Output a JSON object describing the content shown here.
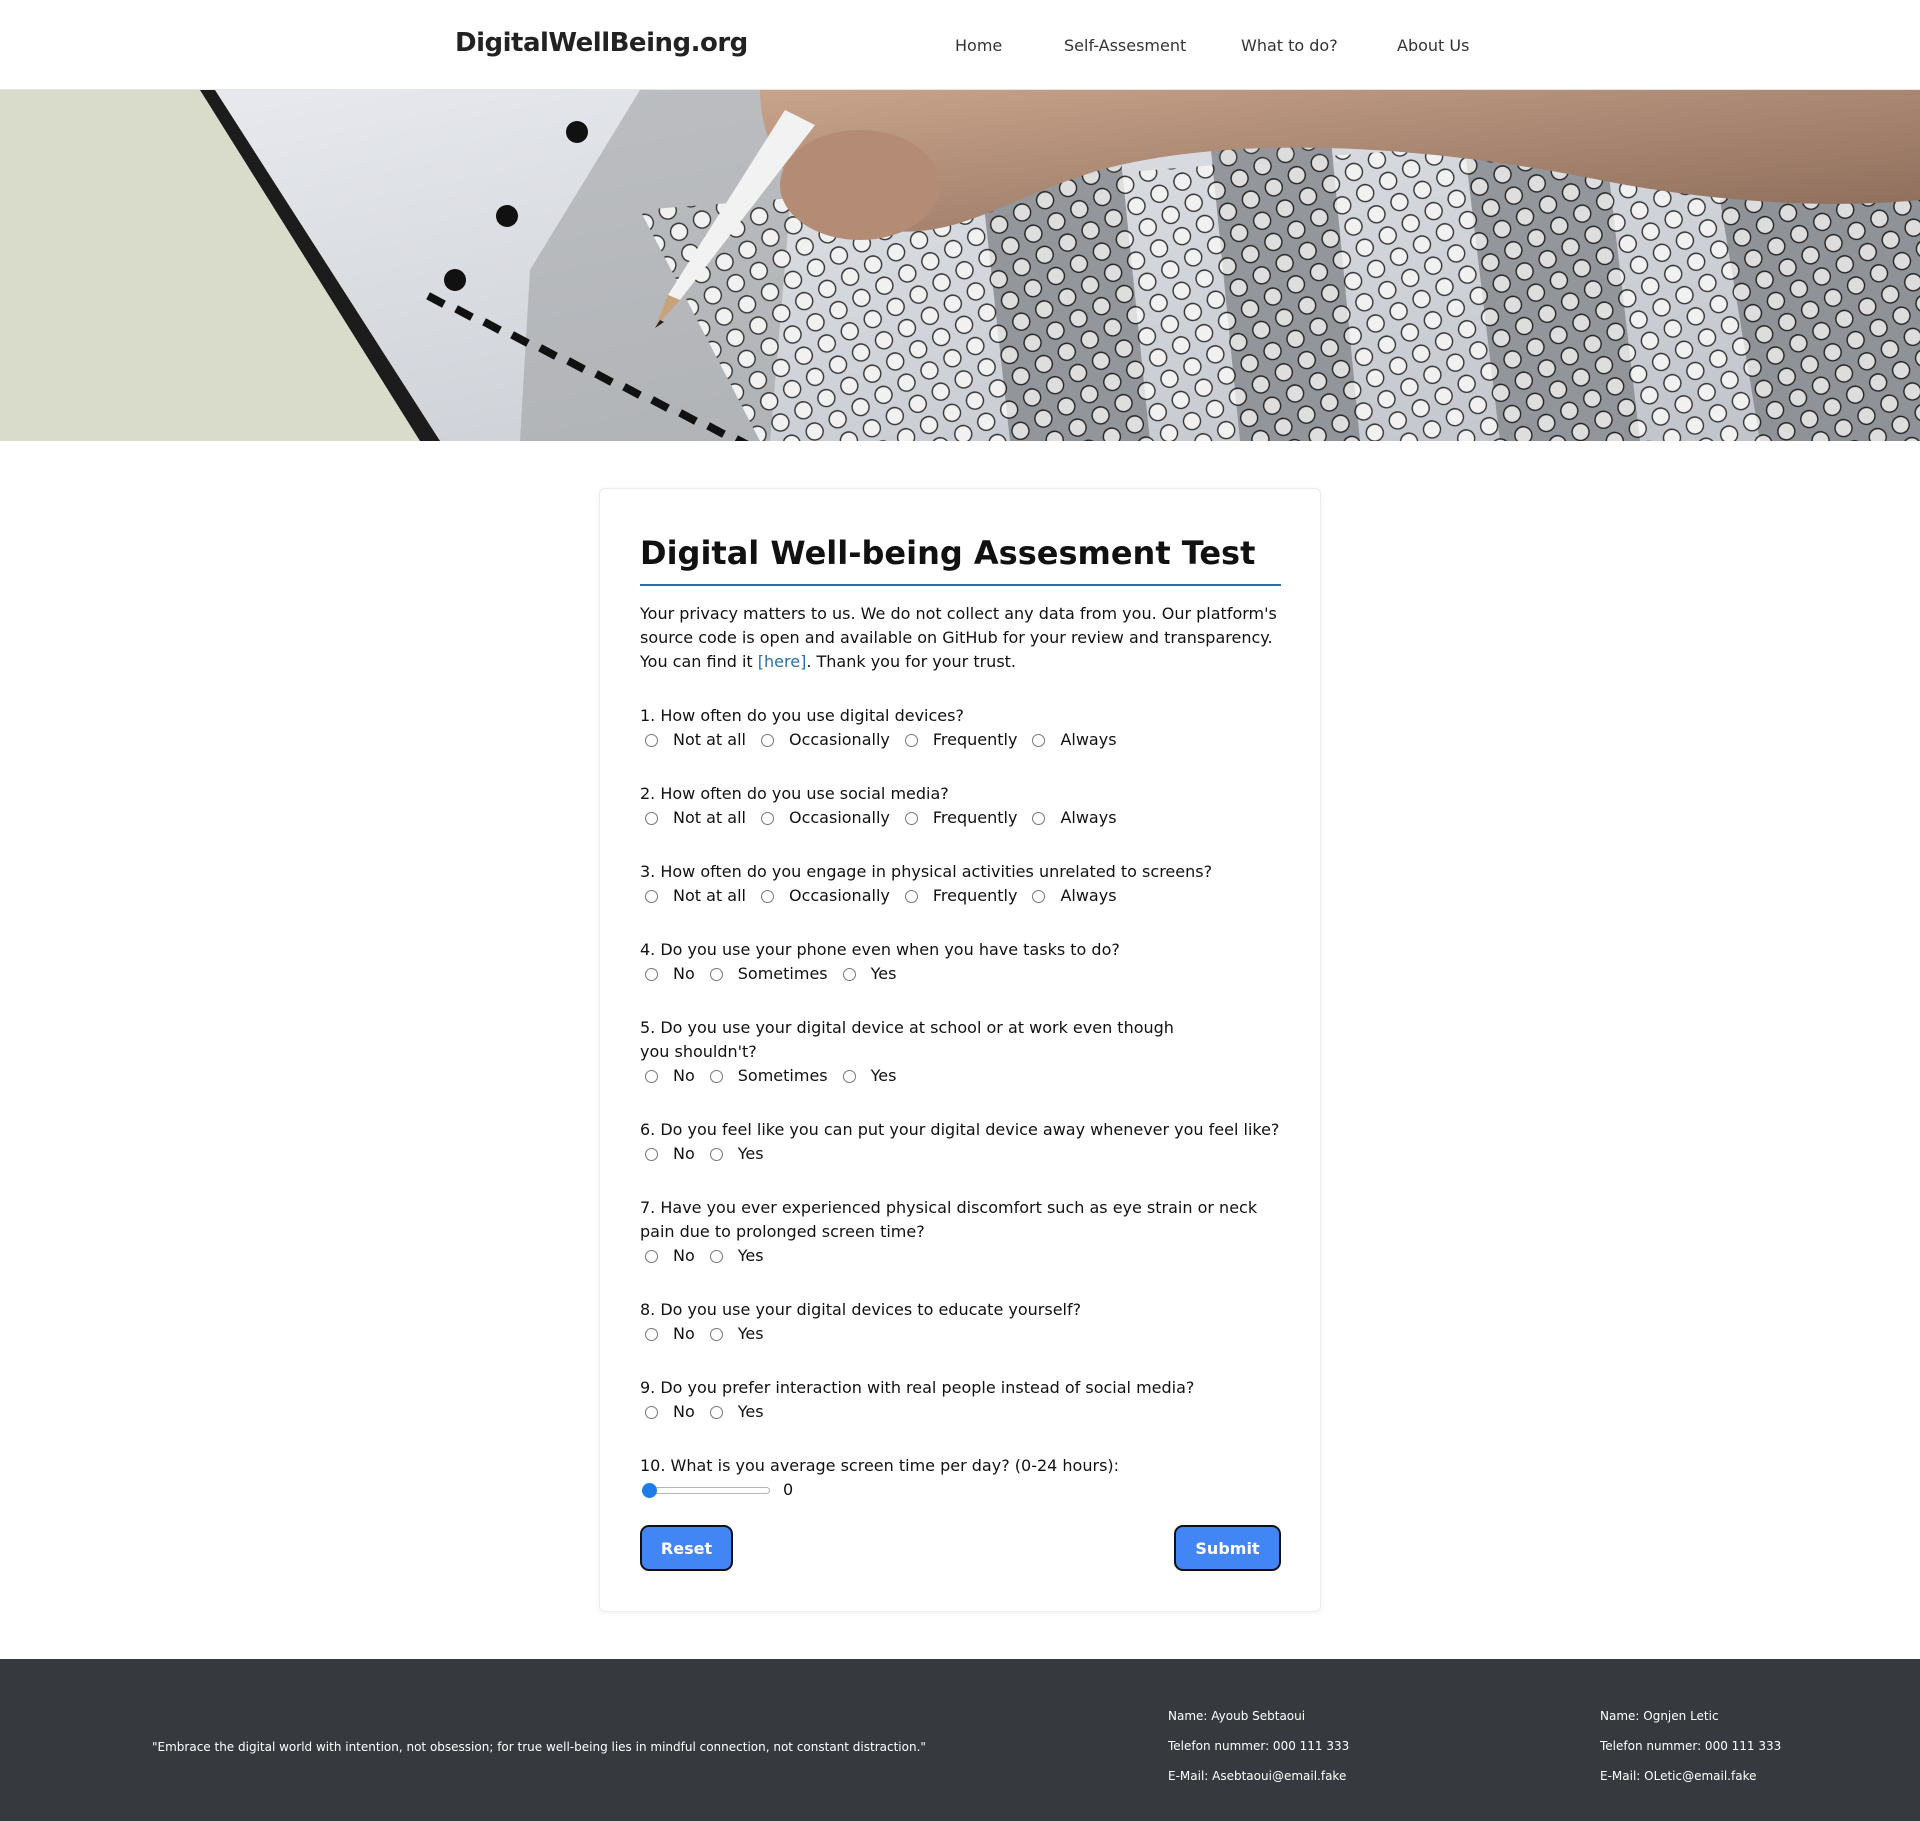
{
  "header": {
    "logo": "DigitalWellBeing.org",
    "nav": [
      "Home",
      "Self-Assesment",
      "What to do?",
      "About Us"
    ]
  },
  "hero": {
    "image_description": "Close-up of a pencil filling in bubbles on a multiple-choice answer sheet"
  },
  "form": {
    "title": "Digital Well-being Assesment Test",
    "intro_before_link": "Your privacy matters to us. We do not collect any data from you. Our platform's source code is open and available on GitHub for your review and transparency. You can find it ",
    "intro_link": "[here]",
    "intro_after_link": ". Thank you for your trust.",
    "questions": [
      {
        "text": "1. How often do you use digital devices?",
        "options": [
          "Not at all",
          "Occasionally",
          "Frequently",
          "Always"
        ]
      },
      {
        "text": "2. How often do you use social media?",
        "options": [
          "Not at all",
          "Occasionally",
          "Frequently",
          "Always"
        ]
      },
      {
        "text": "3. How often do you engage in physical activities unrelated to screens?",
        "options": [
          "Not at all",
          "Occasionally",
          "Frequently",
          "Always"
        ]
      },
      {
        "text": "4. Do you use your phone even when you have tasks to do?",
        "options": [
          "No",
          "Sometimes",
          "Yes"
        ]
      },
      {
        "text": "5. Do you use your digital device at school or at work even though you shouldn't?",
        "options": [
          "No",
          "Sometimes",
          "Yes"
        ]
      },
      {
        "text": "6. Do you feel like you can put your digital device away whenever you feel like?",
        "options": [
          "No",
          "Yes"
        ]
      },
      {
        "text": "7. Have you ever experienced physical discomfort such as eye strain or neck pain due to prolonged screen time?",
        "options": [
          "No",
          "Yes"
        ]
      },
      {
        "text": "8. Do you use your digital devices to educate yourself?",
        "options": [
          "No",
          "Yes"
        ]
      },
      {
        "text": "9. Do you prefer interaction with real people instead of social media?",
        "options": [
          "No",
          "Yes"
        ]
      }
    ],
    "slider_question": {
      "text": "10. What is you average screen time per day? (0-24 hours):",
      "min": 0,
      "max": 24,
      "value": "0"
    },
    "reset_label": "Reset",
    "submit_label": "Submit"
  },
  "footer": {
    "quote": "\"Embrace the digital world with intention, not obsession; for true well-being lies in mindful connection, not constant distraction.\"",
    "contacts": [
      {
        "name": "Name: Ayoub Sebtaoui",
        "phone": "Telefon nummer: 000 111 333",
        "email": "E-Mail: Asebtaoui@email.fake"
      },
      {
        "name": "Name: Ognjen Letic",
        "phone": "Telefon nummer: 000 111 333",
        "email": "E-Mail: OLetic@email.fake"
      }
    ]
  },
  "colors": {
    "accent_link": "#2a6fa8",
    "button": "#4285f4",
    "footer_bg": "#36393d",
    "slider_thumb": "#1f7be8"
  }
}
